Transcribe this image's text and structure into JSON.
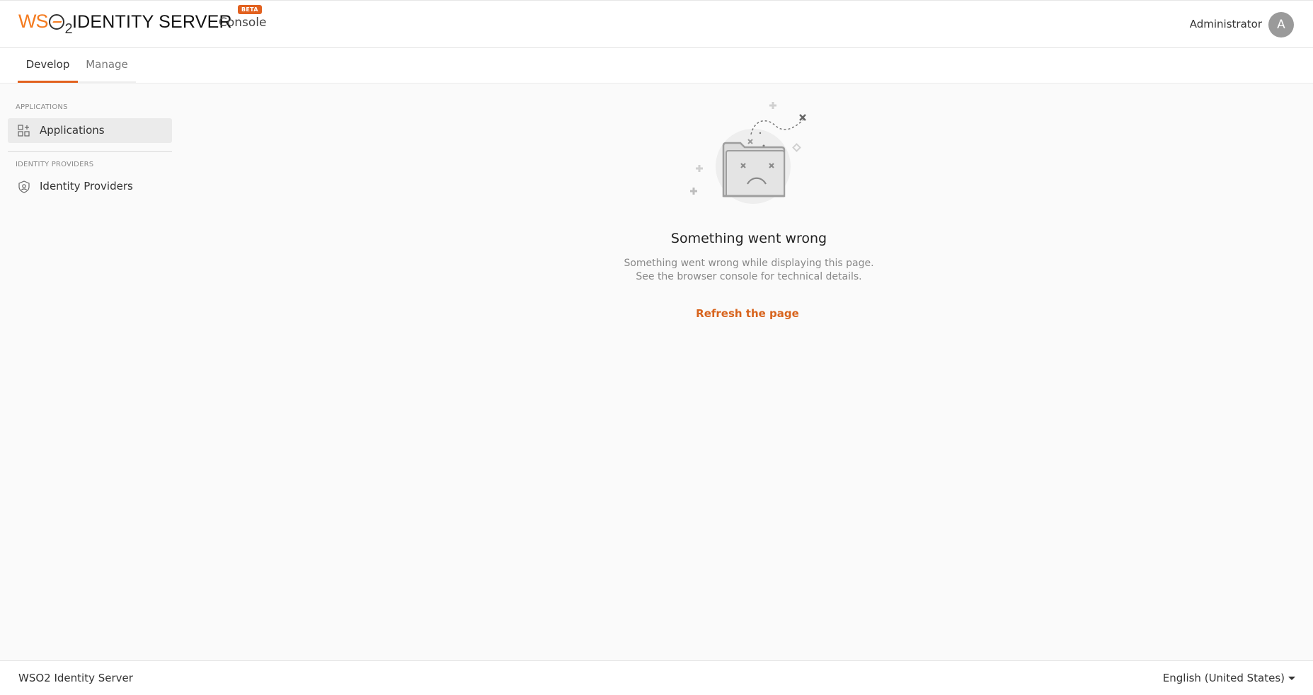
{
  "header": {
    "logo_wso": "WS",
    "logo_sub": "2",
    "product_name": "IDENTITY SERVER",
    "console_label": "Console",
    "beta_badge": "BETA",
    "user_name": "Administrator",
    "avatar_initial": "A"
  },
  "tabs": [
    {
      "label": "Develop",
      "active": true
    },
    {
      "label": "Manage",
      "active": false
    }
  ],
  "sidebar": {
    "sections": [
      {
        "label": "APPLICATIONS",
        "items": [
          {
            "label": "Applications",
            "icon": "applications-icon",
            "active": true
          }
        ]
      },
      {
        "label": "IDENTITY PROVIDERS",
        "items": [
          {
            "label": "Identity Providers",
            "icon": "identity-providers-icon",
            "active": false
          }
        ]
      }
    ]
  },
  "error": {
    "title": "Something went wrong",
    "description_line1": "Something went wrong while displaying this page.",
    "description_line2": "See the browser console for technical details.",
    "action_label": "Refresh the page",
    "illustration": "broken-folder-icon"
  },
  "footer": {
    "brand": "WSO2 Identity Server",
    "language": "English (United States)"
  },
  "colors": {
    "accent": "#e2611f",
    "link": "#d8641d",
    "background": "#fafafa"
  }
}
